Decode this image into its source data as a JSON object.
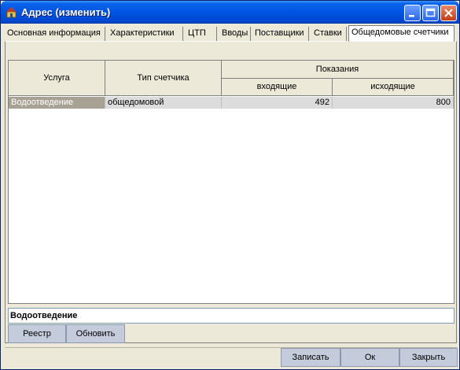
{
  "window": {
    "title": "Адрес (изменить)"
  },
  "tabs": [
    {
      "label": "Основная информация"
    },
    {
      "label": "Характеристики"
    },
    {
      "label": "ЦТП"
    },
    {
      "label": "Вводы"
    },
    {
      "label": "Поставщики"
    },
    {
      "label": "Ставки"
    },
    {
      "label": "Общедомовые счетчики",
      "active": true
    }
  ],
  "grid": {
    "headers": {
      "service": "Услуга",
      "meter_type": "Тип счетчика",
      "readings": "Показания",
      "incoming": "входящие",
      "outgoing": "исходящие"
    },
    "rows": [
      {
        "service": "Водоотведение",
        "meter_type": "общедомовой",
        "incoming": "492",
        "outgoing": "800"
      }
    ]
  },
  "summary": {
    "text": "Водоотведение"
  },
  "buttons": {
    "registry": "Реестр",
    "refresh": "Обновить",
    "save": "Записать",
    "ok": "Ок",
    "close": "Закрыть"
  }
}
